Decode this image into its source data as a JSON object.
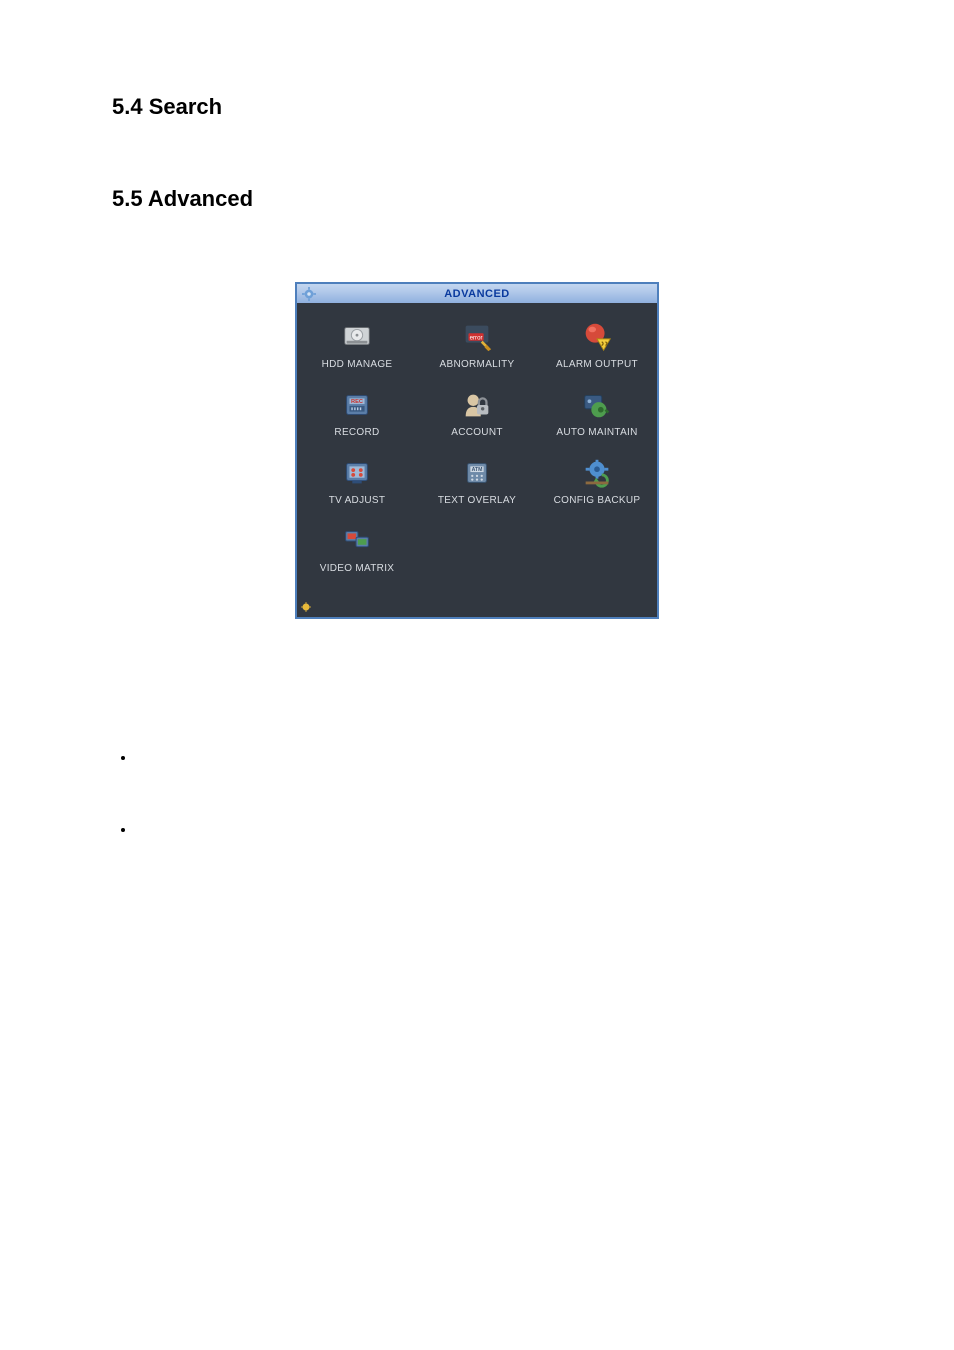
{
  "sections": {
    "search": "5.4   Search",
    "advanced": "5.5   Advanced"
  },
  "window": {
    "title": "ADVANCED",
    "items": [
      {
        "id": "hdd-manage",
        "label": "HDD MANAGE",
        "icon": "hdd-icon"
      },
      {
        "id": "abnormality",
        "label": "ABNORMALITY",
        "icon": "error-icon"
      },
      {
        "id": "alarm-output",
        "label": "ALARM OUTPUT",
        "icon": "alarm-icon"
      },
      {
        "id": "record",
        "label": "RECORD",
        "icon": "record-icon"
      },
      {
        "id": "account",
        "label": "ACCOUNT",
        "icon": "account-icon"
      },
      {
        "id": "auto-maintain",
        "label": "AUTO MAINTAIN",
        "icon": "maintain-icon"
      },
      {
        "id": "tv-adjust",
        "label": "TV ADJUST",
        "icon": "tv-icon"
      },
      {
        "id": "text-overlay",
        "label": "TEXT OVERLAY",
        "icon": "atm-icon"
      },
      {
        "id": "config-backup",
        "label": "CONFIG BACKUP",
        "icon": "backup-icon"
      },
      {
        "id": "video-matrix",
        "label": "VIDEO MATRIX",
        "icon": "matrix-icon"
      }
    ]
  }
}
